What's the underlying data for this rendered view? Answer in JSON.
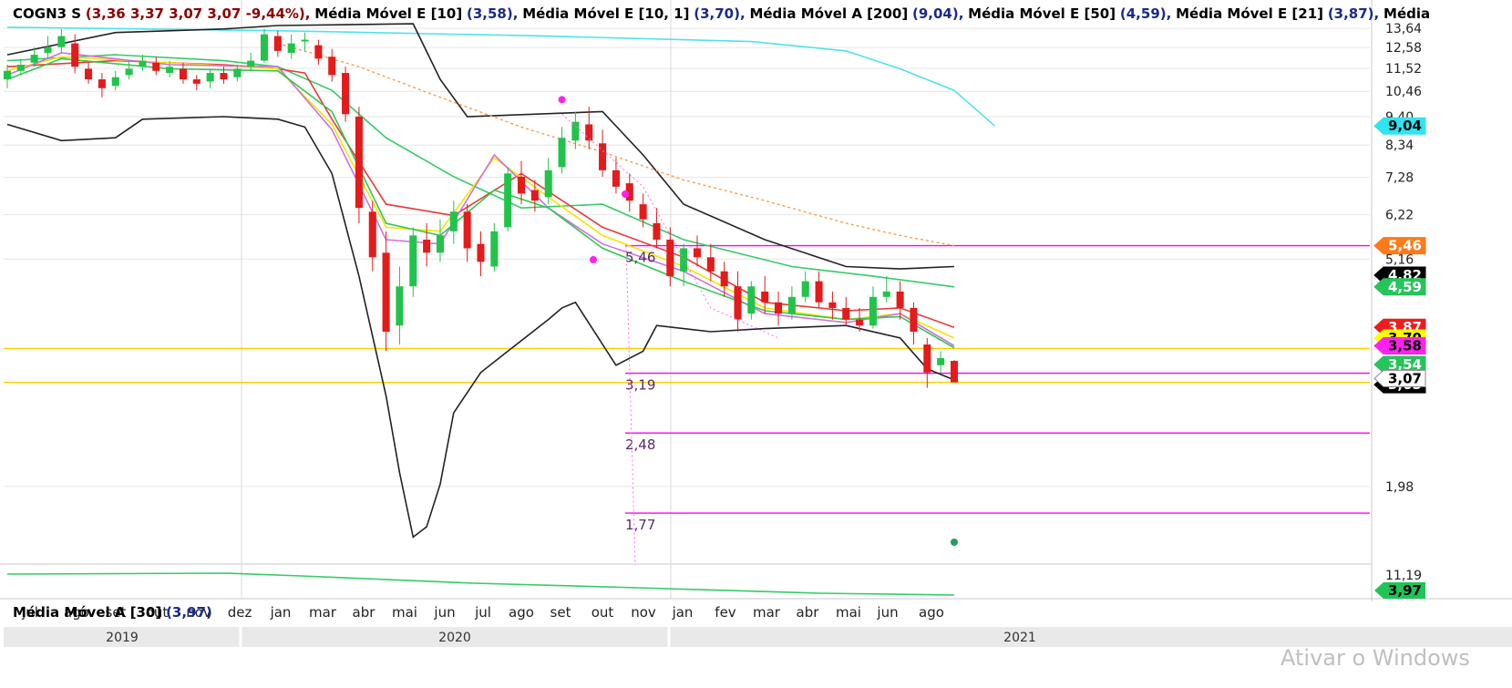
{
  "header": {
    "symbol": "COGN3 S",
    "ohlc": "(3,36  3,37  3,07  3,07  -9,44%),",
    "indicators": [
      {
        "name": "Média Móvel E [10]",
        "value": "(3,58),"
      },
      {
        "name": "Média Móvel E [10, 1]",
        "value": "(3,70),"
      },
      {
        "name": "Média Móvel A [200]",
        "value": "(9,04),"
      },
      {
        "name": "Média Móvel E [50]",
        "value": "(4,59),"
      },
      {
        "name": "Média Móvel E [21]",
        "value": "(3,87),"
      },
      {
        "name": "Média",
        "value": ""
      }
    ]
  },
  "subchart": {
    "name": "Média Móvel A [30]",
    "value": "(3,97)",
    "axis_label": "11,19",
    "tag": "3,97",
    "tag_color": "#1fc458"
  },
  "watermark": "Ativar o Windows",
  "chart_data": {
    "type": "line",
    "scale": "log",
    "ylim": [
      1.45,
      13.8
    ],
    "y_ticks": [
      "13,64",
      "12,58",
      "11,52",
      "10,46",
      "9,40",
      "8,34",
      "7,28",
      "6,22",
      "5,16",
      "1,98"
    ],
    "x_labels": [
      "jul",
      "ago",
      "set",
      "out",
      "nov",
      "dez",
      "jan",
      "mar",
      "abr",
      "mai",
      "jun",
      "jul",
      "ago",
      "set",
      "out",
      "nov",
      "jan",
      "fev",
      "mar",
      "abr",
      "mai",
      "jun",
      "ago"
    ],
    "years": [
      "2019",
      "2020",
      "2021"
    ],
    "horizontal_lines": [
      {
        "value": 5.46,
        "color": "#ff00ff"
      },
      {
        "value": 3.54,
        "color": "#ffcc00"
      },
      {
        "value": 3.19,
        "color": "#ff00ff"
      },
      {
        "value": 3.07,
        "color": "#ffcc00"
      },
      {
        "value": 2.48,
        "color": "#ff00ff"
      },
      {
        "value": 1.77,
        "color": "#ff00ff"
      }
    ],
    "fib_labels": [
      "5,46",
      "3,19",
      "2,48",
      "1,77"
    ],
    "price_tags": [
      {
        "text": "9,04",
        "value": 9.04,
        "bg": "#2fe3f0",
        "fg": "#000000"
      },
      {
        "text": "5,46",
        "value": 5.46,
        "bg": "#ff7a1a",
        "fg": "#ffffff"
      },
      {
        "text": "4,82",
        "value": 4.82,
        "bg": "#000000",
        "fg": "#ffffff"
      },
      {
        "text": "4,59",
        "value": 4.59,
        "bg": "#26c45a",
        "fg": "#ffffff"
      },
      {
        "text": "3,87",
        "value": 3.87,
        "bg": "#ee1c1c",
        "fg": "#ffffff"
      },
      {
        "text": "3,70",
        "value": 3.7,
        "bg": "#ffff00",
        "fg": "#000000"
      },
      {
        "text": "3,58",
        "value": 3.58,
        "bg": "#ff22ee",
        "fg": "#000000"
      },
      {
        "text": "3,54",
        "value": 3.31,
        "bg": "#26c45a",
        "fg": "#ffffff"
      },
      {
        "text": "3,05",
        "value": 3.04,
        "bg": "#000000",
        "fg": "#ffffff"
      },
      {
        "text": "3,07",
        "value": 3.12,
        "bg": "#ffffff",
        "fg": "#000000"
      }
    ],
    "series": [
      {
        "name": "Média Móvel A [200]",
        "color": "#4de3ee",
        "values": [
          [
            0,
            13.7
          ],
          [
            20,
            13.5
          ],
          [
            40,
            13.2
          ],
          [
            55,
            12.9
          ],
          [
            62,
            12.4
          ],
          [
            66,
            11.5
          ],
          [
            70,
            10.5
          ],
          [
            73,
            9.04
          ]
        ]
      },
      {
        "name": "Média Móvel E [50]",
        "color": "#33cc66",
        "values": [
          [
            0,
            11.9
          ],
          [
            8,
            12.2
          ],
          [
            16,
            11.9
          ],
          [
            20,
            11.6
          ],
          [
            24,
            10.5
          ],
          [
            28,
            8.6
          ],
          [
            33,
            7.3
          ],
          [
            38,
            6.4
          ],
          [
            44,
            6.5
          ],
          [
            50,
            5.6
          ],
          [
            58,
            5.0
          ],
          [
            64,
            4.8
          ],
          [
            70,
            4.59
          ]
        ]
      },
      {
        "name": "Média Móvel E [21]",
        "color": "#e83a3a",
        "values": [
          [
            0,
            11.6
          ],
          [
            8,
            11.9
          ],
          [
            16,
            11.7
          ],
          [
            20,
            11.5
          ],
          [
            22,
            11.3
          ],
          [
            24,
            9.3
          ],
          [
            28,
            6.5
          ],
          [
            33,
            6.2
          ],
          [
            38,
            7.4
          ],
          [
            44,
            5.9
          ],
          [
            50,
            5.2
          ],
          [
            56,
            4.3
          ],
          [
            62,
            4.15
          ],
          [
            66,
            4.2
          ],
          [
            70,
            3.87
          ]
        ]
      },
      {
        "name": "Média Móvel E [10, 1]",
        "color": "#f3e600",
        "values": [
          [
            0,
            11.4
          ],
          [
            4,
            12.1
          ],
          [
            12,
            11.8
          ],
          [
            20,
            11.5
          ],
          [
            24,
            9.1
          ],
          [
            28,
            5.9
          ],
          [
            32,
            5.8
          ],
          [
            36,
            7.9
          ],
          [
            40,
            6.7
          ],
          [
            44,
            5.7
          ],
          [
            50,
            5.0
          ],
          [
            56,
            4.2
          ],
          [
            62,
            4.0
          ],
          [
            66,
            4.1
          ],
          [
            70,
            3.7
          ]
        ]
      },
      {
        "name": "Média Móvel E [10]",
        "color": "#d070e0",
        "values": [
          [
            0,
            11.2
          ],
          [
            4,
            12.3
          ],
          [
            12,
            11.7
          ],
          [
            20,
            11.6
          ],
          [
            24,
            8.9
          ],
          [
            28,
            5.6
          ],
          [
            32,
            5.5
          ],
          [
            36,
            8.0
          ],
          [
            40,
            6.4
          ],
          [
            44,
            5.5
          ],
          [
            50,
            4.9
          ],
          [
            56,
            4.1
          ],
          [
            62,
            3.95
          ],
          [
            66,
            4.1
          ],
          [
            70,
            3.58
          ]
        ]
      },
      {
        "name": "Média Móvel E [10, 1] low",
        "color": "#32c850",
        "values": [
          [
            0,
            11.0
          ],
          [
            4,
            12.0
          ],
          [
            12,
            11.5
          ],
          [
            20,
            11.4
          ],
          [
            24,
            9.6
          ],
          [
            28,
            6.0
          ],
          [
            32,
            5.7
          ],
          [
            36,
            6.9
          ],
          [
            40,
            6.4
          ],
          [
            44,
            5.4
          ],
          [
            50,
            4.7
          ],
          [
            56,
            4.15
          ],
          [
            62,
            4.0
          ],
          [
            66,
            4.05
          ],
          [
            70,
            3.55
          ]
        ]
      },
      {
        "name": "Bollinger upper",
        "color": "#222222",
        "values": [
          [
            0,
            12.2
          ],
          [
            8,
            13.4
          ],
          [
            16,
            13.6
          ],
          [
            20,
            13.8
          ],
          [
            30,
            13.9
          ],
          [
            32,
            11.0
          ],
          [
            34,
            9.4
          ],
          [
            44,
            9.6
          ],
          [
            47,
            8.0
          ],
          [
            50,
            6.5
          ],
          [
            56,
            5.6
          ],
          [
            62,
            5.0
          ],
          [
            66,
            4.95
          ],
          [
            70,
            5.0
          ]
        ]
      },
      {
        "name": "Bollinger lower",
        "color": "#222222",
        "values": [
          [
            0,
            9.1
          ],
          [
            4,
            8.5
          ],
          [
            8,
            8.6
          ],
          [
            10,
            9.3
          ],
          [
            16,
            9.4
          ],
          [
            20,
            9.3
          ],
          [
            22,
            9.0
          ],
          [
            24,
            7.4
          ],
          [
            26,
            4.8
          ],
          [
            28,
            2.9
          ],
          [
            29,
            2.1
          ],
          [
            30,
            1.6
          ],
          [
            31,
            1.67
          ],
          [
            32,
            2.0
          ],
          [
            33,
            2.7
          ],
          [
            35,
            3.2
          ],
          [
            37,
            3.5
          ],
          [
            40,
            4.0
          ],
          [
            41,
            4.2
          ],
          [
            42,
            4.3
          ],
          [
            45,
            3.3
          ],
          [
            47,
            3.5
          ],
          [
            48,
            3.9
          ],
          [
            52,
            3.8
          ],
          [
            56,
            3.85
          ],
          [
            62,
            3.9
          ],
          [
            66,
            3.7
          ],
          [
            68,
            3.25
          ],
          [
            70,
            3.1
          ]
        ]
      }
    ],
    "candles": [
      [
        0,
        11.0,
        11.4,
        11.7,
        10.6
      ],
      [
        1,
        11.4,
        11.7,
        12.0,
        11.2
      ],
      [
        2,
        11.8,
        12.2,
        12.6,
        11.6
      ],
      [
        3,
        12.3,
        12.6,
        13.2,
        12.0
      ],
      [
        4,
        12.6,
        13.2,
        13.6,
        12.3
      ],
      [
        5,
        12.8,
        11.6,
        13.3,
        11.3
      ],
      [
        6,
        11.5,
        11.0,
        11.8,
        10.8
      ],
      [
        7,
        11.0,
        10.6,
        11.3,
        10.2
      ],
      [
        8,
        10.7,
        11.1,
        11.4,
        10.5
      ],
      [
        9,
        11.2,
        11.5,
        11.9,
        11.0
      ],
      [
        10,
        11.6,
        11.9,
        12.2,
        11.4
      ],
      [
        11,
        11.8,
        11.4,
        12.1,
        11.2
      ],
      [
        12,
        11.3,
        11.6,
        11.9,
        11.1
      ],
      [
        13,
        11.5,
        11.0,
        11.8,
        10.8
      ],
      [
        14,
        11.0,
        10.8,
        11.2,
        10.5
      ],
      [
        15,
        10.9,
        11.3,
        11.5,
        10.6
      ],
      [
        16,
        11.3,
        11.0,
        11.6,
        10.8
      ],
      [
        17,
        11.1,
        11.5,
        11.7,
        10.9
      ],
      [
        18,
        11.6,
        11.9,
        12.3,
        11.4
      ],
      [
        19,
        11.9,
        13.3,
        13.6,
        11.8
      ],
      [
        20,
        13.2,
        12.4,
        13.5,
        12.1
      ],
      [
        21,
        12.3,
        12.8,
        13.3,
        12.0
      ],
      [
        22,
        12.9,
        13.0,
        13.4,
        12.4
      ],
      [
        23,
        12.7,
        12.0,
        13.0,
        11.7
      ],
      [
        24,
        12.1,
        11.2,
        12.5,
        10.9
      ],
      [
        25,
        11.3,
        9.5,
        11.6,
        9.2
      ],
      [
        26,
        9.4,
        6.4,
        9.8,
        6.0
      ],
      [
        27,
        6.3,
        5.2,
        6.6,
        4.9
      ],
      [
        28,
        5.3,
        3.8,
        5.8,
        3.5
      ],
      [
        29,
        3.9,
        4.6,
        5.0,
        3.6
      ],
      [
        30,
        4.6,
        5.7,
        5.9,
        4.4
      ],
      [
        31,
        5.6,
        5.3,
        6.0,
        5.0
      ],
      [
        32,
        5.3,
        5.7,
        6.1,
        5.1
      ],
      [
        33,
        5.8,
        6.3,
        6.6,
        5.5
      ],
      [
        34,
        6.3,
        5.4,
        6.5,
        5.1
      ],
      [
        35,
        5.5,
        5.1,
        5.8,
        4.8
      ],
      [
        36,
        5.0,
        5.8,
        6.0,
        4.9
      ],
      [
        37,
        5.9,
        7.4,
        7.6,
        5.8
      ],
      [
        38,
        7.3,
        6.8,
        7.8,
        6.5
      ],
      [
        39,
        6.9,
        6.6,
        7.2,
        6.3
      ],
      [
        40,
        6.7,
        7.5,
        7.9,
        6.5
      ],
      [
        41,
        7.6,
        8.6,
        9.0,
        7.4
      ],
      [
        42,
        8.5,
        9.2,
        9.6,
        8.2
      ],
      [
        43,
        9.1,
        8.5,
        9.8,
        8.2
      ],
      [
        44,
        8.4,
        7.5,
        8.9,
        7.3
      ],
      [
        45,
        7.5,
        7.0,
        7.9,
        6.8
      ],
      [
        46,
        7.1,
        6.6,
        7.4,
        6.3
      ],
      [
        47,
        6.5,
        6.1,
        6.8,
        5.9
      ],
      [
        48,
        6.0,
        5.6,
        6.4,
        5.4
      ],
      [
        49,
        5.6,
        4.8,
        5.9,
        4.6
      ],
      [
        50,
        4.9,
        5.4,
        5.5,
        4.6
      ],
      [
        51,
        5.4,
        5.2,
        5.7,
        5.0
      ],
      [
        52,
        5.2,
        4.9,
        5.5,
        4.7
      ],
      [
        53,
        4.9,
        4.6,
        5.1,
        4.4
      ],
      [
        54,
        4.6,
        4.0,
        4.9,
        3.8
      ],
      [
        55,
        4.1,
        4.6,
        4.7,
        4.0
      ],
      [
        56,
        4.5,
        4.3,
        4.8,
        4.1
      ],
      [
        57,
        4.3,
        4.1,
        4.5,
        3.9
      ],
      [
        58,
        4.1,
        4.4,
        4.6,
        4.0
      ],
      [
        59,
        4.4,
        4.7,
        4.9,
        4.3
      ],
      [
        60,
        4.7,
        4.3,
        4.9,
        4.2
      ],
      [
        61,
        4.3,
        4.2,
        4.5,
        4.0
      ],
      [
        62,
        4.2,
        4.0,
        4.4,
        3.9
      ],
      [
        63,
        4.0,
        3.9,
        4.2,
        3.8
      ],
      [
        64,
        3.9,
        4.4,
        4.6,
        3.85
      ],
      [
        65,
        4.4,
        4.5,
        4.8,
        4.3
      ],
      [
        66,
        4.5,
        4.2,
        4.7,
        4.0
      ],
      [
        67,
        4.2,
        3.8,
        4.3,
        3.6
      ],
      [
        68,
        3.6,
        3.2,
        3.7,
        3.0
      ],
      [
        69,
        3.3,
        3.4,
        3.5,
        3.2
      ],
      [
        70,
        3.36,
        3.07,
        3.37,
        3.07
      ]
    ]
  }
}
